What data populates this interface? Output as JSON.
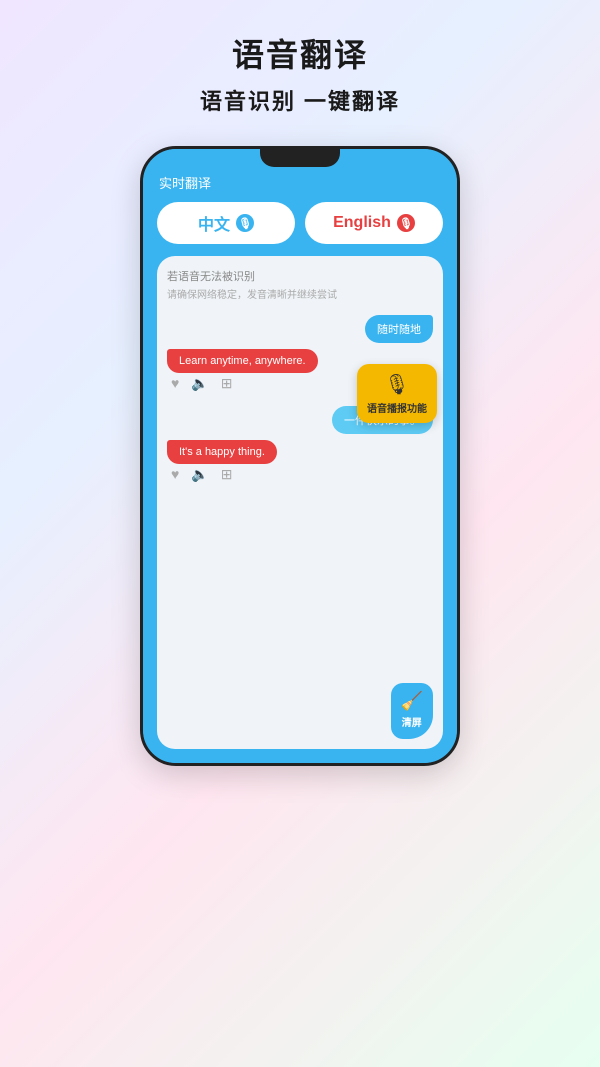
{
  "header": {
    "title": "语音翻译",
    "subtitle": "语音识别 一键翻译"
  },
  "app": {
    "bar_title": "实时翻译",
    "lang_zh": "中文",
    "lang_en": "English",
    "error_main": "若语音无法被识别",
    "error_sub": "请确保网络稳定，发音清晰并继续尝试",
    "bubble1_right": "随时随地",
    "bubble1_left": "Learn anytime, anywhere.",
    "bubble2_right": "一件快乐的事。",
    "bubble2_left": "It's a happy thing.",
    "tooltip_text": "语音播报功能",
    "clean_text": "清屏"
  }
}
